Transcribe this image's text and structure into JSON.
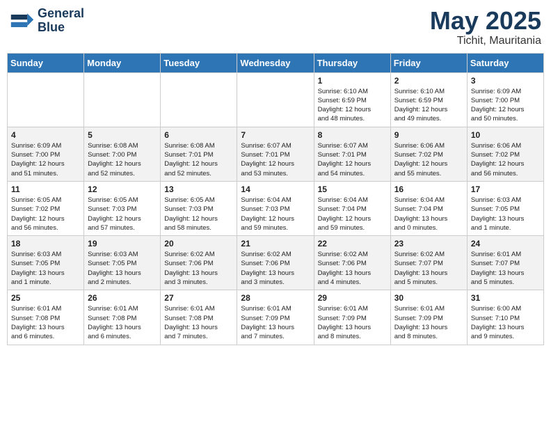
{
  "header": {
    "logo_line1": "General",
    "logo_line2": "Blue",
    "month_title": "May 2025",
    "location": "Tichit, Mauritania"
  },
  "weekdays": [
    "Sunday",
    "Monday",
    "Tuesday",
    "Wednesday",
    "Thursday",
    "Friday",
    "Saturday"
  ],
  "rows": [
    [
      {
        "day": "",
        "info": ""
      },
      {
        "day": "",
        "info": ""
      },
      {
        "day": "",
        "info": ""
      },
      {
        "day": "",
        "info": ""
      },
      {
        "day": "1",
        "info": "Sunrise: 6:10 AM\nSunset: 6:59 PM\nDaylight: 12 hours\nand 48 minutes."
      },
      {
        "day": "2",
        "info": "Sunrise: 6:10 AM\nSunset: 6:59 PM\nDaylight: 12 hours\nand 49 minutes."
      },
      {
        "day": "3",
        "info": "Sunrise: 6:09 AM\nSunset: 7:00 PM\nDaylight: 12 hours\nand 50 minutes."
      }
    ],
    [
      {
        "day": "4",
        "info": "Sunrise: 6:09 AM\nSunset: 7:00 PM\nDaylight: 12 hours\nand 51 minutes."
      },
      {
        "day": "5",
        "info": "Sunrise: 6:08 AM\nSunset: 7:00 PM\nDaylight: 12 hours\nand 52 minutes."
      },
      {
        "day": "6",
        "info": "Sunrise: 6:08 AM\nSunset: 7:01 PM\nDaylight: 12 hours\nand 52 minutes."
      },
      {
        "day": "7",
        "info": "Sunrise: 6:07 AM\nSunset: 7:01 PM\nDaylight: 12 hours\nand 53 minutes."
      },
      {
        "day": "8",
        "info": "Sunrise: 6:07 AM\nSunset: 7:01 PM\nDaylight: 12 hours\nand 54 minutes."
      },
      {
        "day": "9",
        "info": "Sunrise: 6:06 AM\nSunset: 7:02 PM\nDaylight: 12 hours\nand 55 minutes."
      },
      {
        "day": "10",
        "info": "Sunrise: 6:06 AM\nSunset: 7:02 PM\nDaylight: 12 hours\nand 56 minutes."
      }
    ],
    [
      {
        "day": "11",
        "info": "Sunrise: 6:05 AM\nSunset: 7:02 PM\nDaylight: 12 hours\nand 56 minutes."
      },
      {
        "day": "12",
        "info": "Sunrise: 6:05 AM\nSunset: 7:03 PM\nDaylight: 12 hours\nand 57 minutes."
      },
      {
        "day": "13",
        "info": "Sunrise: 6:05 AM\nSunset: 7:03 PM\nDaylight: 12 hours\nand 58 minutes."
      },
      {
        "day": "14",
        "info": "Sunrise: 6:04 AM\nSunset: 7:03 PM\nDaylight: 12 hours\nand 59 minutes."
      },
      {
        "day": "15",
        "info": "Sunrise: 6:04 AM\nSunset: 7:04 PM\nDaylight: 12 hours\nand 59 minutes."
      },
      {
        "day": "16",
        "info": "Sunrise: 6:04 AM\nSunset: 7:04 PM\nDaylight: 13 hours\nand 0 minutes."
      },
      {
        "day": "17",
        "info": "Sunrise: 6:03 AM\nSunset: 7:05 PM\nDaylight: 13 hours\nand 1 minute."
      }
    ],
    [
      {
        "day": "18",
        "info": "Sunrise: 6:03 AM\nSunset: 7:05 PM\nDaylight: 13 hours\nand 1 minute."
      },
      {
        "day": "19",
        "info": "Sunrise: 6:03 AM\nSunset: 7:05 PM\nDaylight: 13 hours\nand 2 minutes."
      },
      {
        "day": "20",
        "info": "Sunrise: 6:02 AM\nSunset: 7:06 PM\nDaylight: 13 hours\nand 3 minutes."
      },
      {
        "day": "21",
        "info": "Sunrise: 6:02 AM\nSunset: 7:06 PM\nDaylight: 13 hours\nand 3 minutes."
      },
      {
        "day": "22",
        "info": "Sunrise: 6:02 AM\nSunset: 7:06 PM\nDaylight: 13 hours\nand 4 minutes."
      },
      {
        "day": "23",
        "info": "Sunrise: 6:02 AM\nSunset: 7:07 PM\nDaylight: 13 hours\nand 5 minutes."
      },
      {
        "day": "24",
        "info": "Sunrise: 6:01 AM\nSunset: 7:07 PM\nDaylight: 13 hours\nand 5 minutes."
      }
    ],
    [
      {
        "day": "25",
        "info": "Sunrise: 6:01 AM\nSunset: 7:08 PM\nDaylight: 13 hours\nand 6 minutes."
      },
      {
        "day": "26",
        "info": "Sunrise: 6:01 AM\nSunset: 7:08 PM\nDaylight: 13 hours\nand 6 minutes."
      },
      {
        "day": "27",
        "info": "Sunrise: 6:01 AM\nSunset: 7:08 PM\nDaylight: 13 hours\nand 7 minutes."
      },
      {
        "day": "28",
        "info": "Sunrise: 6:01 AM\nSunset: 7:09 PM\nDaylight: 13 hours\nand 7 minutes."
      },
      {
        "day": "29",
        "info": "Sunrise: 6:01 AM\nSunset: 7:09 PM\nDaylight: 13 hours\nand 8 minutes."
      },
      {
        "day": "30",
        "info": "Sunrise: 6:01 AM\nSunset: 7:09 PM\nDaylight: 13 hours\nand 8 minutes."
      },
      {
        "day": "31",
        "info": "Sunrise: 6:00 AM\nSunset: 7:10 PM\nDaylight: 13 hours\nand 9 minutes."
      }
    ]
  ]
}
